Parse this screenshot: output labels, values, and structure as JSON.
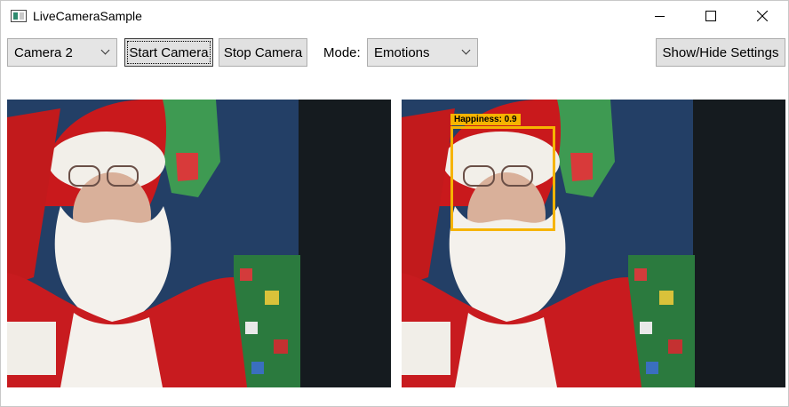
{
  "window": {
    "title": "LiveCameraSample"
  },
  "toolbar": {
    "camera_select": {
      "value": "Camera 2"
    },
    "start_label": "Start Camera",
    "stop_label": "Stop Camera",
    "mode_label": "Mode:",
    "mode_select": {
      "value": "Emotions"
    },
    "settings_label": "Show/Hide Settings"
  },
  "result": {
    "tag": "Happiness: 0.9",
    "box_color": "#f6b400"
  }
}
